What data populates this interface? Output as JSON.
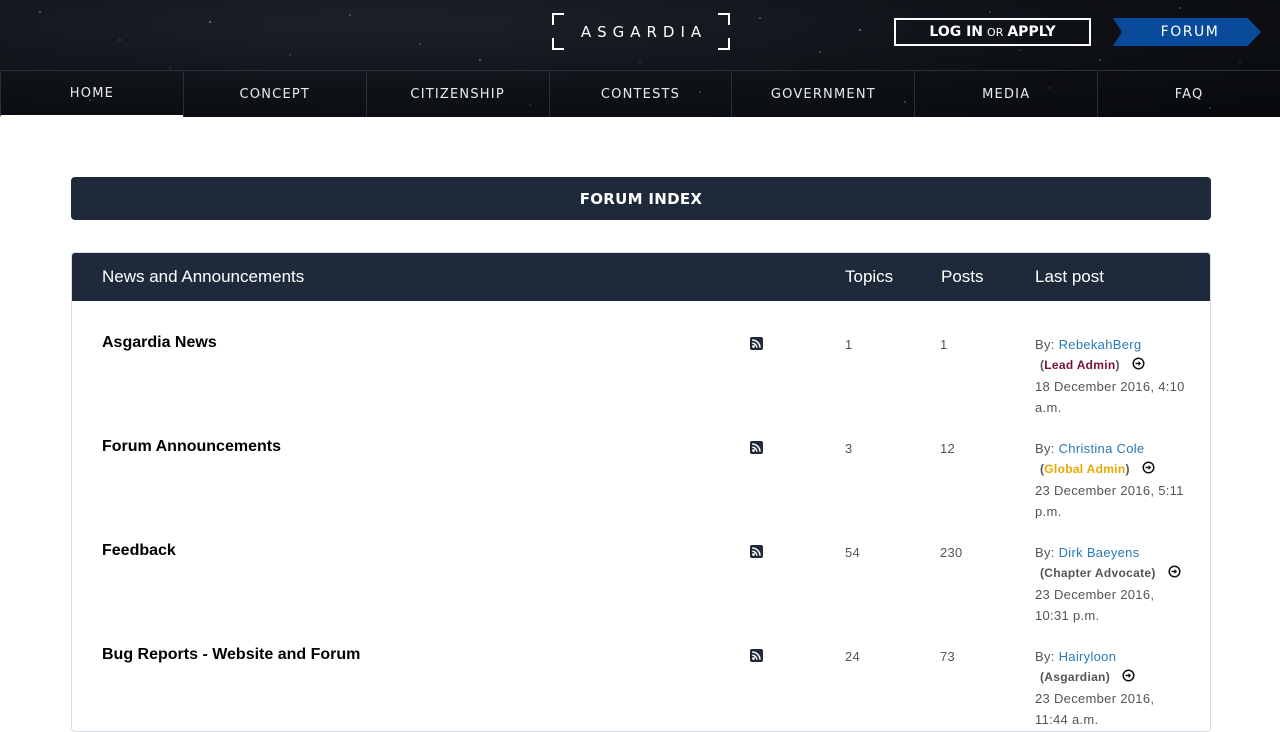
{
  "header": {
    "logo": "ASGARDIA",
    "login": {
      "log_in": "LOG IN",
      "or": "OR",
      "apply": "APPLY"
    },
    "forum_tab": "FORUM"
  },
  "nav": {
    "items": [
      {
        "label": "HOME",
        "active": true
      },
      {
        "label": "CONCEPT"
      },
      {
        "label": "CITIZENSHIP"
      },
      {
        "label": "CONTESTS"
      },
      {
        "label": "GOVERNMENT"
      },
      {
        "label": "MEDIA"
      },
      {
        "label": "FAQ"
      }
    ]
  },
  "banner": {
    "title": "FORUM INDEX"
  },
  "forum_table": {
    "section_title": "News and Announcements",
    "col_topics": "Topics",
    "col_posts": "Posts",
    "col_last": "Last post",
    "rows": [
      {
        "name": "Asgardia News",
        "topics": "1",
        "posts": "1",
        "by": "By:",
        "user": "RebekahBerg",
        "role": "Lead Admin",
        "role_color": "#7a1036",
        "date_line1": "18 December 2016, 4:10",
        "date_line2": "a.m."
      },
      {
        "name": "Forum Announcements",
        "topics": "3",
        "posts": "12",
        "by": "By:",
        "user": "Christina Cole",
        "role": "Global Admin",
        "role_color": "#e6a800",
        "date_line1": "23 December 2016, 5:11",
        "date_line2": "p.m."
      },
      {
        "name": "Feedback",
        "topics": "54",
        "posts": "230",
        "by": "By:",
        "user": "Dirk Baeyens",
        "role": "Chapter Advocate",
        "role_color": "#555555",
        "date_line1": "23 December 2016,",
        "date_line2": "10:31 p.m."
      },
      {
        "name": "Bug Reports - Website and Forum",
        "topics": "24",
        "posts": "73",
        "by": "By:",
        "user": "Hairyloon",
        "role": "Asgardian",
        "role_color": "#555555",
        "date_line1": "23 December 2016,",
        "date_line2": "11:44 a.m."
      }
    ]
  },
  "icons": {
    "rss": "rss-icon",
    "goto": "goto-post-icon"
  },
  "colors": {
    "header_bg": "#0e1116",
    "panel_dark": "#1e2a3a",
    "forum_blue": "#0a4a9a",
    "link": "#2a7ab8"
  }
}
